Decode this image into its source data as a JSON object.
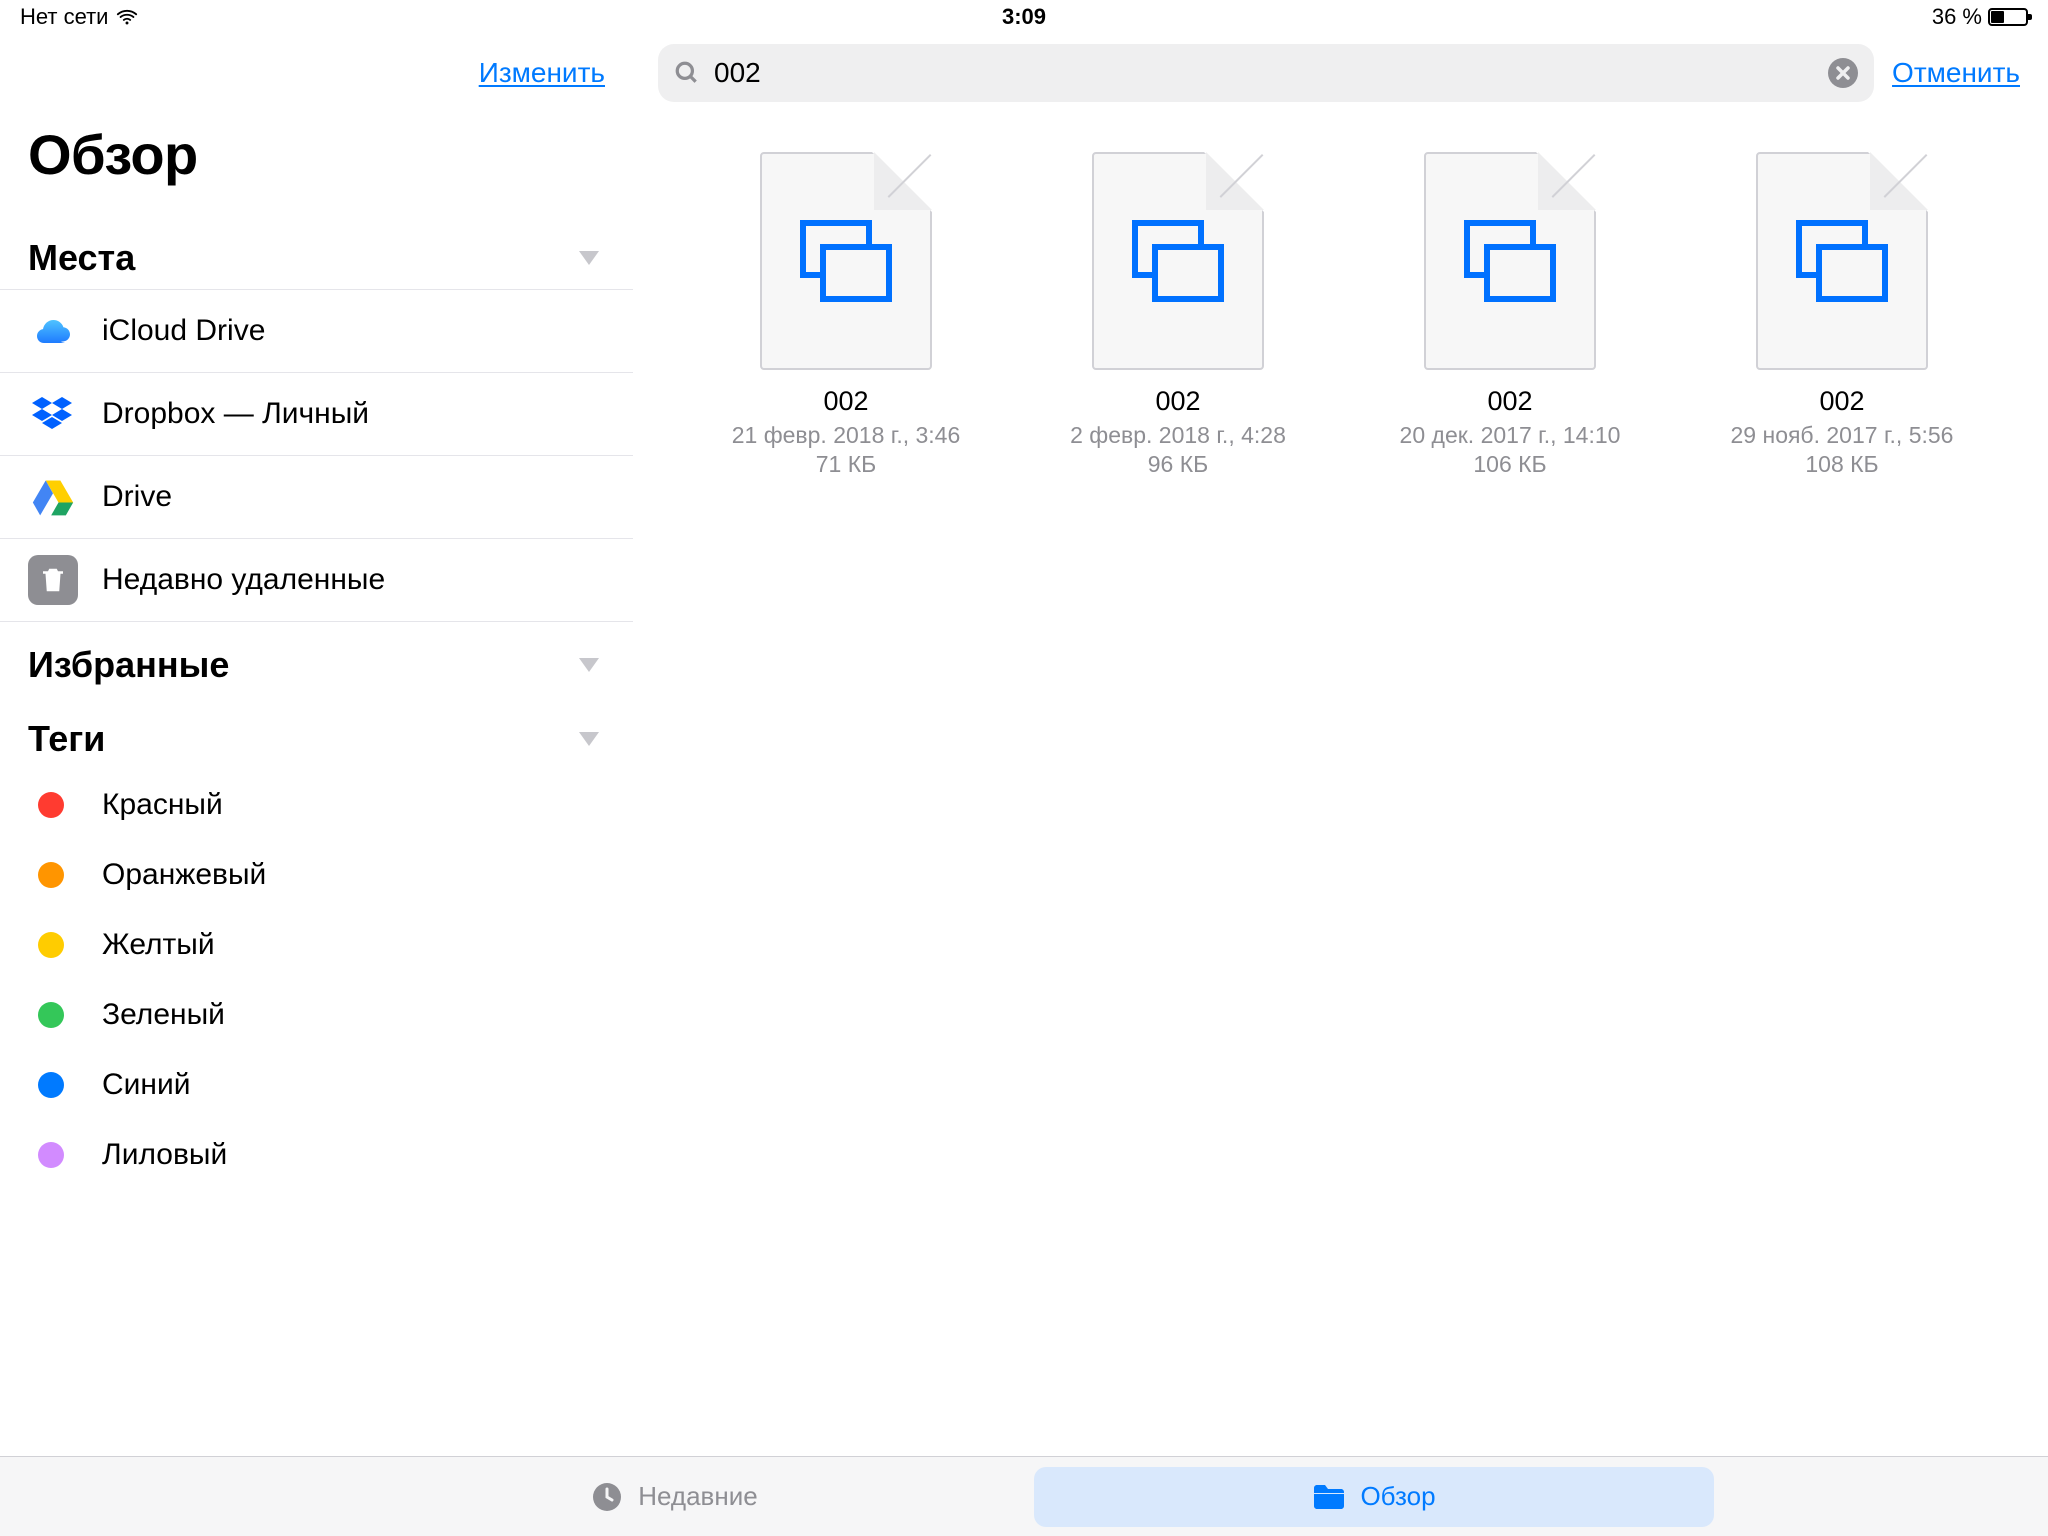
{
  "status": {
    "network": "Нет сети",
    "time": "3:09",
    "battery": "36 %"
  },
  "sidebar": {
    "edit": "Изменить",
    "title": "Обзор",
    "sections": {
      "places": "Места",
      "favorites": "Избранные",
      "tags": "Теги"
    },
    "locations": [
      {
        "label": "iCloud Drive",
        "icon": "icloud"
      },
      {
        "label": "Dropbox — Личный",
        "icon": "dropbox"
      },
      {
        "label": "Drive",
        "icon": "gdrive"
      },
      {
        "label": "Недавно удаленные",
        "icon": "trash"
      }
    ],
    "tags": [
      {
        "label": "Красный",
        "color": "#ff3b30"
      },
      {
        "label": "Оранжевый",
        "color": "#ff9500"
      },
      {
        "label": "Желтый",
        "color": "#ffcc00"
      },
      {
        "label": "Зеленый",
        "color": "#34c759"
      },
      {
        "label": "Синий",
        "color": "#007aff"
      },
      {
        "label": "Лиловый",
        "color": "#d28bff"
      }
    ]
  },
  "search": {
    "query": "002",
    "cancel": "Отменить"
  },
  "results": [
    {
      "name": "002",
      "meta": "21 февр. 2018 г., 3:46",
      "size": "71 КБ"
    },
    {
      "name": "002",
      "meta": "2 февр. 2018 г., 4:28",
      "size": "96 КБ"
    },
    {
      "name": "002",
      "meta": "20 дек. 2017 г., 14:10",
      "size": "106 КБ"
    },
    {
      "name": "002",
      "meta": "29 нояб. 2017 г., 5:56",
      "size": "108 КБ"
    }
  ],
  "tabs": {
    "recent": "Недавние",
    "browse": "Обзор"
  }
}
